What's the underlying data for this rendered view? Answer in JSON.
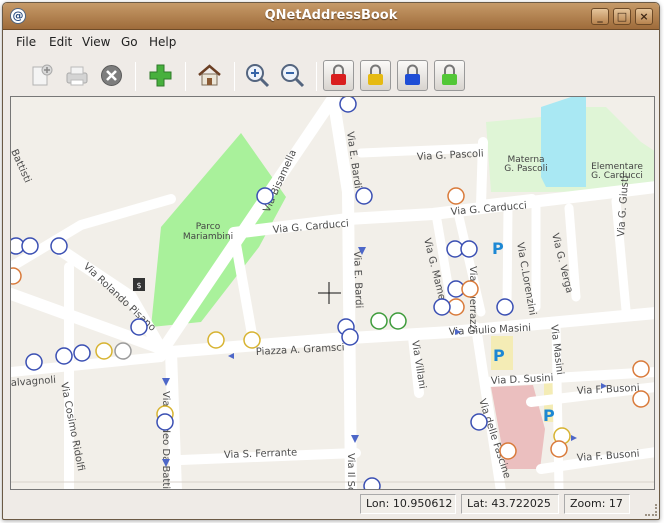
{
  "window": {
    "title": "QNetAddressBook",
    "controls": {
      "minimize": "_",
      "maximize": "□",
      "close": "×"
    },
    "app_icon": "qnet-app-icon"
  },
  "menubar": [
    {
      "label": "File"
    },
    {
      "label": "Edit"
    },
    {
      "label": "View"
    },
    {
      "label": "Go"
    },
    {
      "label": "Help"
    }
  ],
  "toolbar": {
    "icons": [
      "new-page-icon",
      "print-icon",
      "stop-icon",
      "add-icon",
      "home-icon",
      "zoom-in-icon",
      "zoom-out-icon",
      "red-lock-icon",
      "yellow-lock-icon",
      "blue-lock-icon",
      "green-lock-icon"
    ]
  },
  "map": {
    "street_labels": {
      "via_bisamella": "Via Bisamella",
      "via_battisti": "Battisti",
      "via_e_bardi_top": "Via E. Bardi",
      "via_g_pascoli": "Via G. Pascoli",
      "via_g_carducci_left": "Via G. Carducci",
      "via_g_carducci_right": "Via G. Carducci",
      "via_e_bardi_mid": "Via E. Bardi",
      "via_rolando_pisano": "Via Rolando Pisano",
      "via_mameli": "Via G. Mameli",
      "via_guerrazzi": "Via Guerrazzi",
      "via_lorenzini": "Via C.Lorenzini",
      "via_verga": "Via G. Verga",
      "via_giusti": "Via G. Giusti",
      "piazza_gramsci": "Piazza A. Gramsci",
      "via_giulio_masini": "Via Giulio Masini",
      "via_masini": "Via Masini",
      "via_villani": "Via Villani",
      "via_d_susini": "Via D. Susini",
      "via_f_busoni_top": "Via F. Busoni",
      "via_f_busoni_bottom": "Via F. Busoni",
      "via_valvagnoli": "alvagnoli",
      "via_cosimo_ridolfi": "Via Cosimo Ridolfi",
      "via_taddeo": "Via Taddeo Da Battifol",
      "via_s_ferrante": "Via S. Ferrante",
      "via_delle_fascine": "Via delle Fascine",
      "via_il_sotto": "Via Il Sotto"
    },
    "place_labels": {
      "parco": "Parco\nMariambini",
      "materna": "Materna\nG. Pascoli",
      "elementare": "Elementare\nG. Carducci"
    },
    "parking": "P",
    "marker_colors": {
      "blue": "#3a4fb3",
      "yellow": "#d7b330",
      "orange": "#d97a3a",
      "green": "#3d9b3a",
      "gray": "#9a9a9a"
    }
  },
  "status": {
    "lon": "Lon: 10.950612",
    "lat": "Lat: 43.722025",
    "zoom": "Zoom: 17"
  }
}
